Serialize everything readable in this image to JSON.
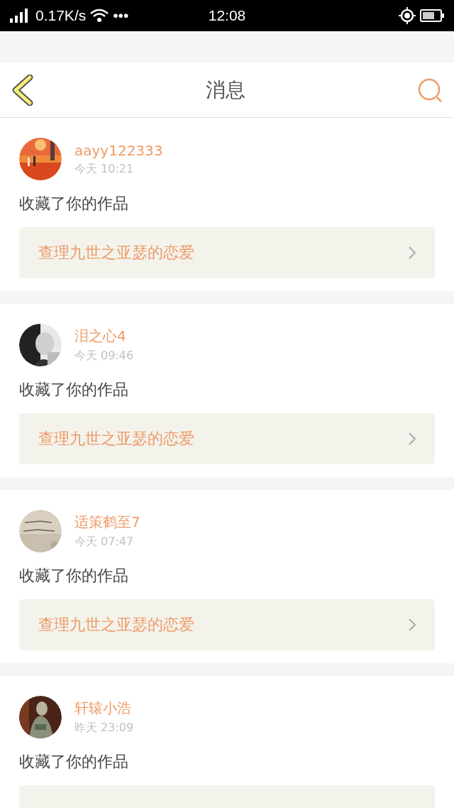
{
  "status_bar": {
    "speed": "0.17K/s",
    "more": "•••",
    "time": "12:08"
  },
  "header": {
    "title": "消息"
  },
  "messages": [
    {
      "user": "aayy122333",
      "time": "今天 10:21",
      "action": "收藏了你的作品",
      "work": "查理九世之亚瑟的恋爱",
      "kind": "picture"
    },
    {
      "user": "泪之心4",
      "time": "今天 09:46",
      "action": "收藏了你的作品",
      "work": "查理九世之亚瑟的恋爱",
      "kind": "picture"
    },
    {
      "user": "适策鹤至7",
      "time": "今天 07:47",
      "action": "收藏了你的作品",
      "work": "查理九世之亚瑟的恋爱",
      "kind": "picture"
    },
    {
      "user": "轩辕小浩",
      "time": "昨天 23:09",
      "action": "收藏了你的作品",
      "kind": "picture"
    }
  ]
}
